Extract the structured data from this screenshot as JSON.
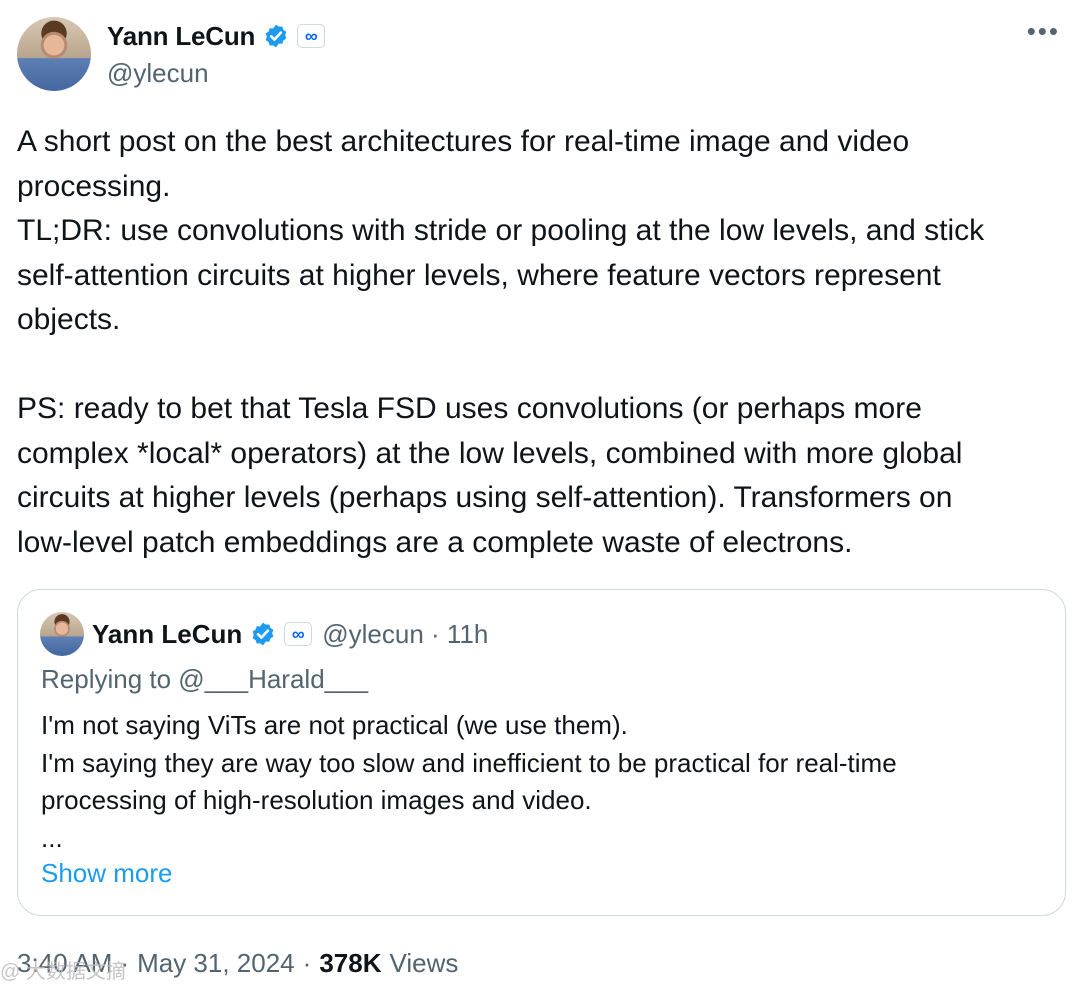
{
  "author": {
    "name": "Yann LeCun",
    "handle": "@ylecun",
    "affiliation_badge": "∞",
    "verified_color": "#1d9bf0"
  },
  "menu_icon": "more-horizontal-icon",
  "post": {
    "text": "A short post on the best architectures for real-time image and video\nprocessing.\nTL;DR: use convolutions with stride or pooling at the low levels, and stick\nself-attention circuits at higher levels, where feature vectors represent\nobjects.\n\nPS: ready to bet that Tesla FSD uses convolutions (or perhaps more\ncomplex *local* operators) at the low levels, combined with more global\ncircuits at higher levels (perhaps using self-attention). Transformers on\nlow-level patch embeddings are a complete waste of electrons."
  },
  "quoted": {
    "name": "Yann LeCun",
    "handle_time": "@ylecun · 11h",
    "replying": "Replying to @___Harald___",
    "text": "I'm not saying ViTs are not practical (we use them).\nI'm saying they are way too slow and inefficient to be practical for real-time\nprocessing of high-resolution images and video.\n...",
    "show_more": "Show more"
  },
  "footer": {
    "time": "3:40 AM",
    "date": "May 31, 2024",
    "views_count": "378K",
    "views_label": "Views"
  },
  "watermark": "@ 大数据文摘"
}
